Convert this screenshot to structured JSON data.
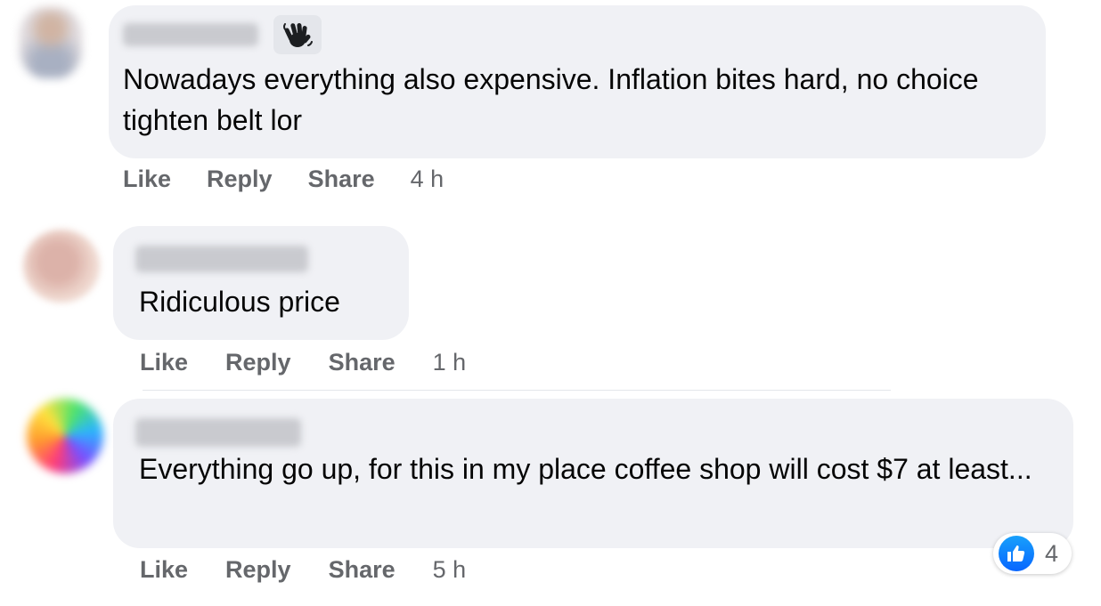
{
  "comments": [
    {
      "text": "Nowadays everything also expensive. Inflation bites hard, no choice tighten belt lor",
      "badge_icon": "waving-hand-icon",
      "actions": {
        "like": "Like",
        "reply": "Reply",
        "share": "Share"
      },
      "time": "4 h"
    },
    {
      "text": "Ridiculous price",
      "actions": {
        "like": "Like",
        "reply": "Reply",
        "share": "Share"
      },
      "time": "1 h"
    },
    {
      "text": "Everything go up, for this in my place coffee shop will cost $7 at least...",
      "actions": {
        "like": "Like",
        "reply": "Reply",
        "share": "Share"
      },
      "time": "5 h",
      "reactions": {
        "icon": "like-icon",
        "count": "4",
        "color": "#0866ff"
      }
    }
  ],
  "colors": {
    "bubble": "#f0f1f5",
    "text": "#050505",
    "secondary": "#65676b"
  }
}
